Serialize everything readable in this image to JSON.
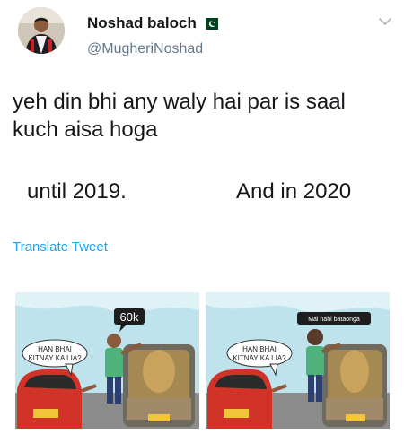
{
  "tweet": {
    "author_name": "Noshad baloch",
    "handle": "@MugheriNoshad",
    "text": "yeh din bhi any waly hai par is saal kuch aisa hoga",
    "line_left": "until 2019.",
    "line_right": "And in 2020",
    "translate_label": "Translate Tweet"
  },
  "meme": {
    "left_panel": {
      "bubble_top": "60k",
      "bubble_bottom_line1": "HAN BHAI",
      "bubble_bottom_line2": "KITNAY KA LIA?"
    },
    "right_panel": {
      "bubble_top": "Mai nahi bataonga",
      "bubble_bottom_line1": "HAN BHAI",
      "bubble_bottom_line2": "KITNAY KA LIA?"
    }
  },
  "colors": {
    "accent": "#1da1f2",
    "secondary_text": "#657786",
    "flag_green": "#01411c"
  },
  "icons": {
    "flag": "pakistan-flag-icon",
    "chevron": "chevron-down-icon"
  }
}
